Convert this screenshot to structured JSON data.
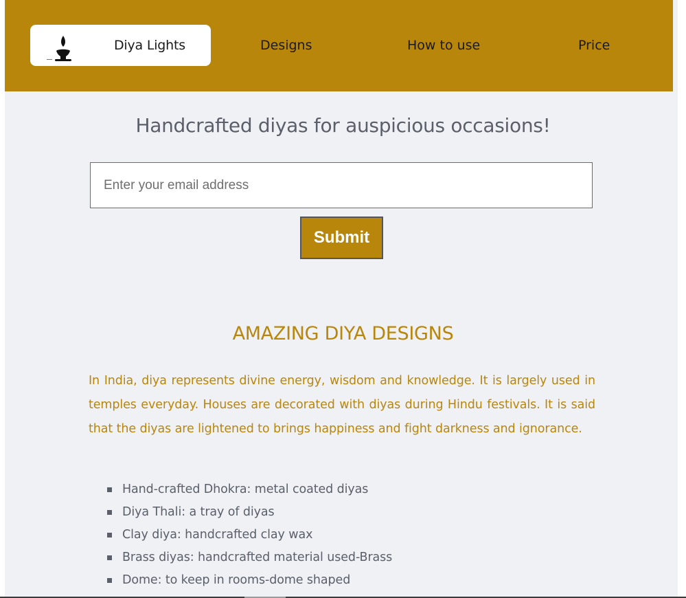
{
  "header": {
    "brand": "Diya Lights",
    "nav": {
      "designs": "Designs",
      "how_to_use": "How to use",
      "price": "Price"
    }
  },
  "hero": {
    "title": "Handcrafted diyas for auspicious occasions!",
    "email_placeholder": "Enter your email address",
    "submit_label": "Submit"
  },
  "designs": {
    "title": "AMAZING DIYA DESIGNS",
    "intro": "In India, diya represents divine energy, wisdom and knowledge. It is largely used in temples everyday. Houses are decorated with diyas during Hindu festivals. It is said that the diyas are lightened to brings happiness and fight darkness and ignorance.",
    "items": [
      "Hand-crafted Dhokra: metal coated diyas",
      "Diya Thali: a tray of diyas",
      "Clay diya: handcrafted clay wax",
      "Brass diyas: handcrafted material used-Brass",
      "Dome: to keep in rooms-dome shaped"
    ]
  },
  "colors": {
    "accent": "#b8860b",
    "page_background": "#f0f1f5",
    "text": "#5a5f6a"
  }
}
